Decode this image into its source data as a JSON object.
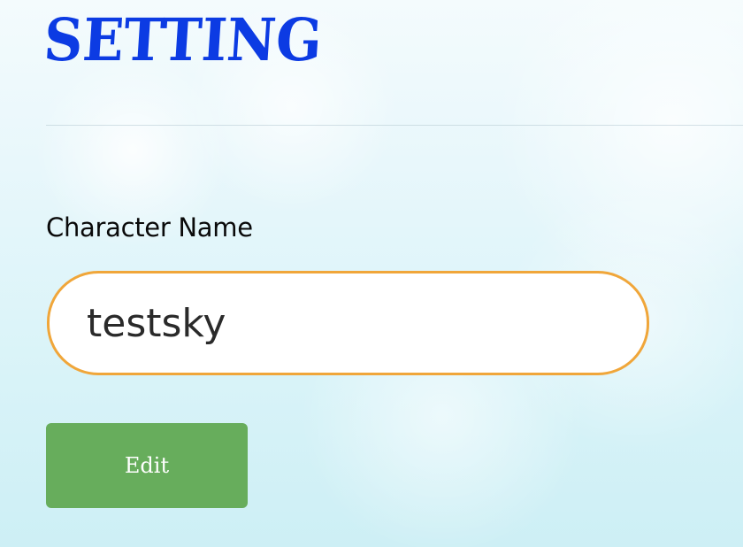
{
  "header": {
    "title": "SETTING"
  },
  "form": {
    "character_name_label": "Character Name",
    "character_name_value": "testsky",
    "edit_label": "Edit"
  },
  "colors": {
    "title": "#0c3be3",
    "input_border": "#f0a63a",
    "edit_button": "#67ad5c"
  }
}
